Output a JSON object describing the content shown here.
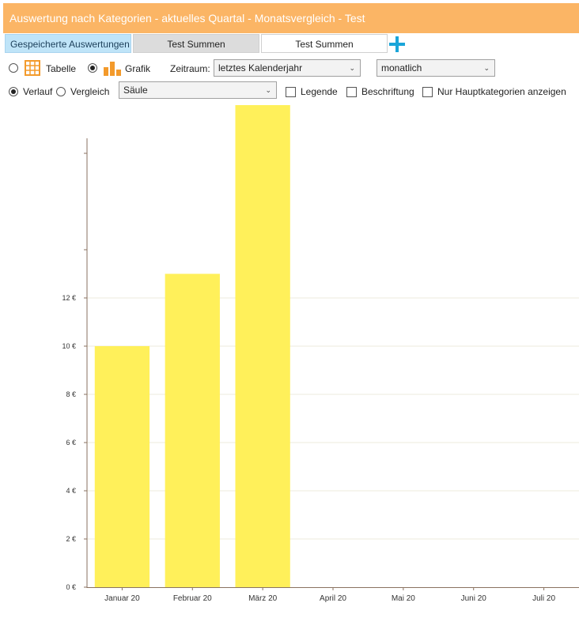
{
  "header": {
    "title": "Auswertung nach Kategorien - aktuelles Quartal - Monatsvergleich - Test"
  },
  "tabs": {
    "saved_label": "Gespeicherte Auswertungen",
    "items": [
      {
        "label": "Test Summen"
      },
      {
        "label": "Test Summen"
      }
    ],
    "add_icon": "plus-icon"
  },
  "controls": {
    "view_table": "Tabelle",
    "view_chart": "Grafik",
    "selected_view": "Grafik",
    "period_label": "Zeitraum:",
    "period_value": "letztes Kalenderjahr",
    "interval_value": "monatlich",
    "mode_history": "Verlauf",
    "mode_compare": "Vergleich",
    "selected_mode": "Verlauf",
    "chart_type_value": "Säule",
    "legend_label": "Legende",
    "labels_label": "Beschriftung",
    "main_categories_label": "Nur Hauptkategorien anzeigen",
    "accent_color": "#fbb565",
    "tab_active_color": "#bfe4f8",
    "add_color": "#1aa5d9"
  },
  "chart_data": {
    "type": "bar",
    "categories": [
      "Januar 20",
      "Februar 20",
      "März 20",
      "April 20",
      "Mai 20",
      "Juni 20",
      "Juli 20"
    ],
    "values": [
      10,
      13,
      20,
      0,
      0,
      0,
      0
    ],
    "y_ticks": [
      "0 €",
      "2 €",
      "4 €",
      "6 €",
      "8 €",
      "10 €",
      "12 €"
    ],
    "y_tick_values": [
      0,
      2,
      4,
      6,
      8,
      10,
      12
    ],
    "ylim": [
      0,
      20
    ],
    "title": "",
    "xlabel": "",
    "ylabel": "",
    "bar_color": "#fff05a",
    "grid": true,
    "legend": "none"
  }
}
